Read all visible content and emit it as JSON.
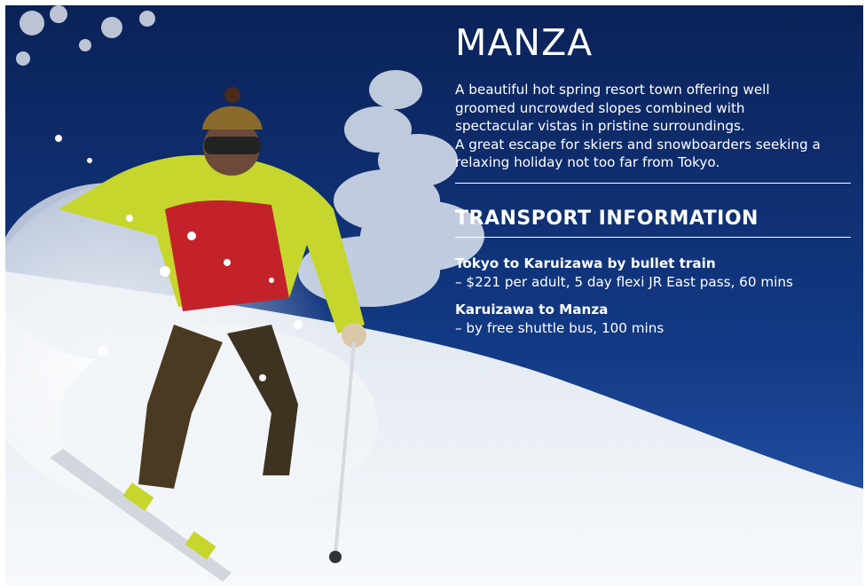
{
  "title": "MANZA",
  "description": [
    "A beautiful hot spring resort town offering well",
    "groomed uncrowded slopes combined with",
    "spectacular vistas in pristine surroundings.",
    "A great escape for skiers and snowboarders seeking a",
    "relaxing holiday not too far from Tokyo."
  ],
  "transport": {
    "heading": "TRANSPORT INFORMATION",
    "routes": [
      {
        "name": "Tokyo to Karuizawa by bullet train",
        "detail": "– $221 per adult, 5 day flexi JR East pass, 60 mins"
      },
      {
        "name": "Karuizawa to Manza",
        "detail": "– by free shuttle bus, 100 mins"
      }
    ]
  },
  "colors": {
    "sky": "#0e2860",
    "jacket_green": "#c6d62c",
    "jacket_red": "#c4222a",
    "snow": "#f2f5f9",
    "text": "#ffffff"
  }
}
